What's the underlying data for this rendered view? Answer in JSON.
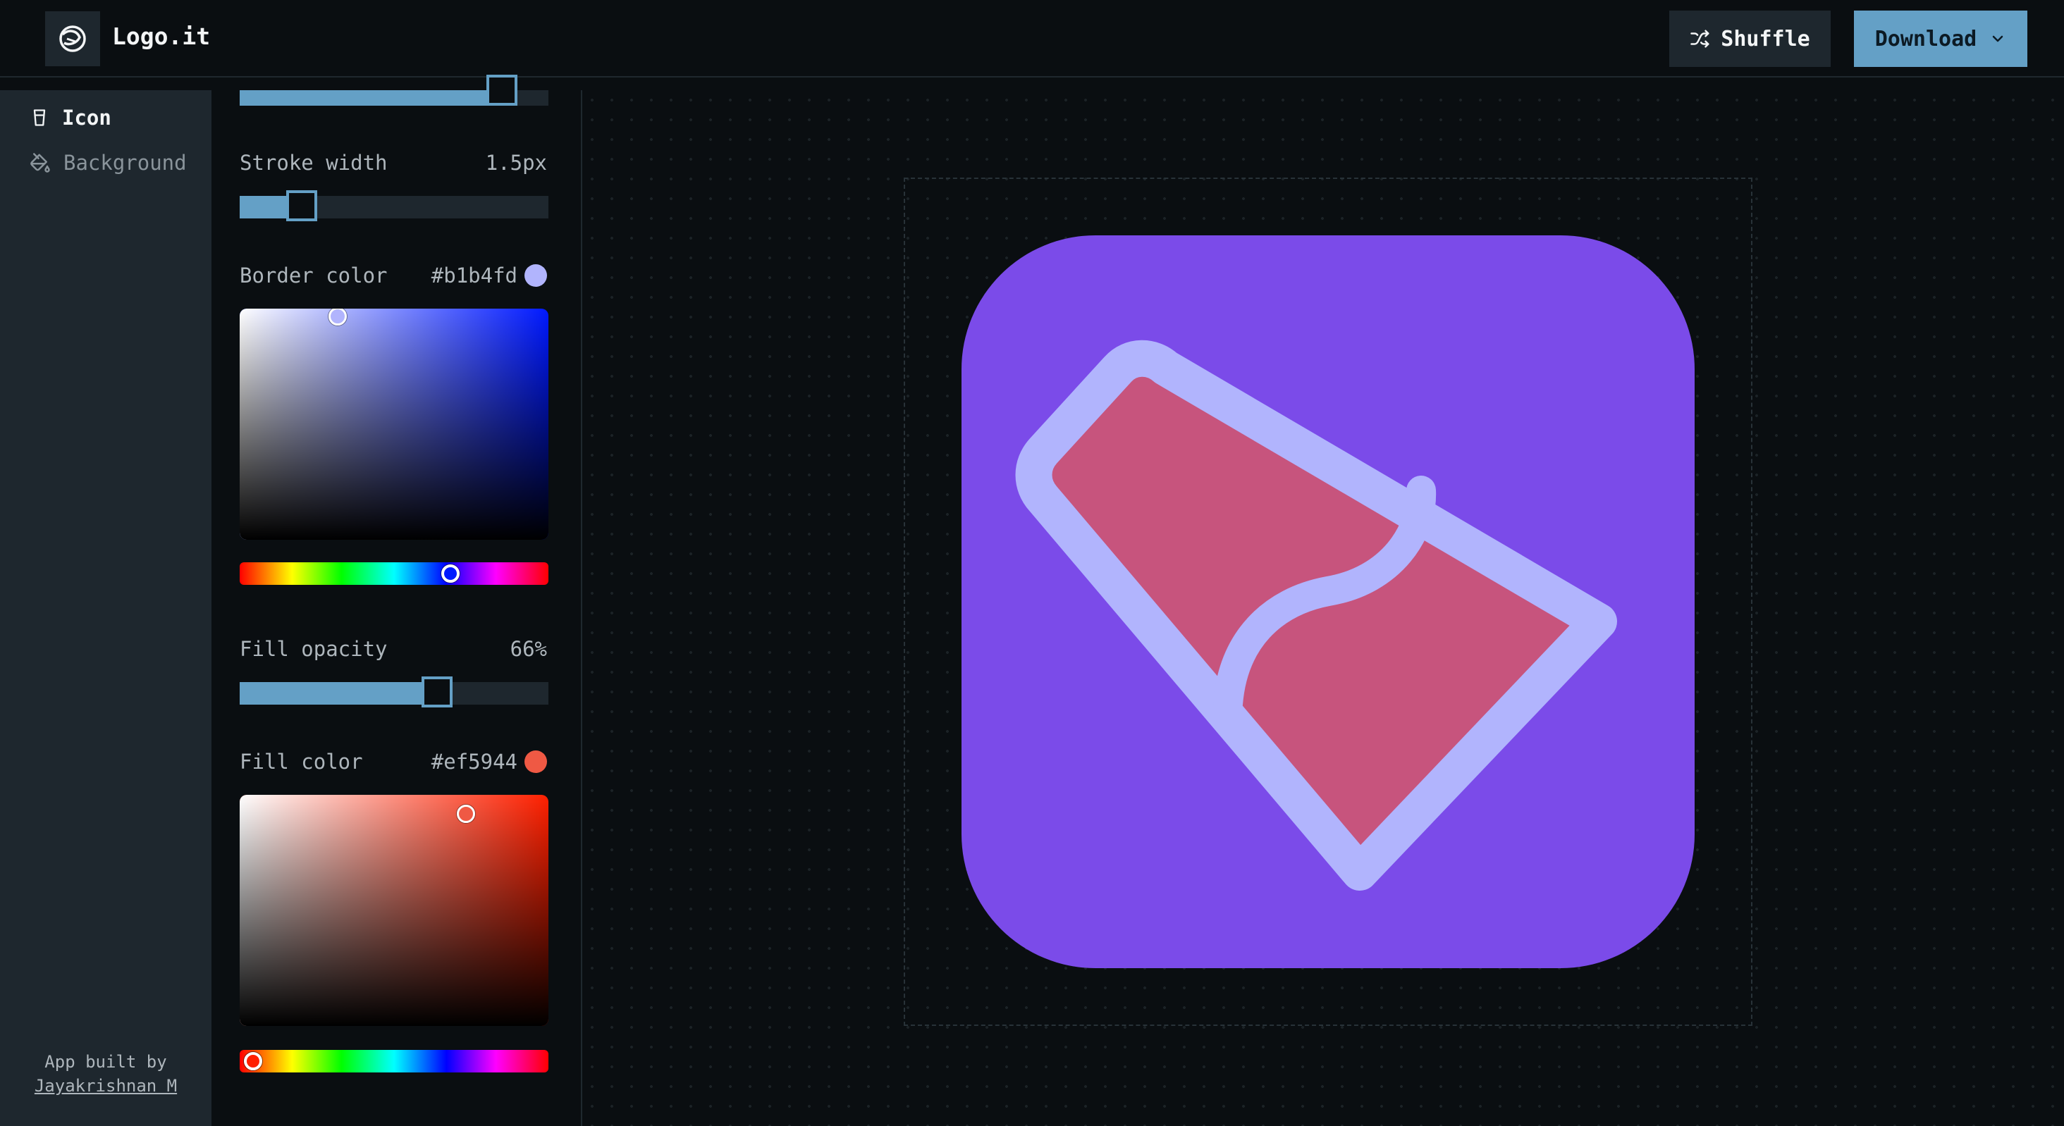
{
  "header": {
    "app_name": "Logo.it",
    "shuffle_label": "Shuffle",
    "download_label": "Download"
  },
  "nav": {
    "items": [
      {
        "label": "Icon",
        "icon": "glass-icon",
        "active": true
      },
      {
        "label": "Background",
        "icon": "paint-bucket-icon",
        "active": false
      }
    ],
    "credit_prefix": "App built by",
    "credit_name": "Jayakrishnan M"
  },
  "controls": {
    "top_slider_fraction": 0.88,
    "stroke_width": {
      "label": "Stroke width",
      "value": "1.5px",
      "fraction": 0.2
    },
    "border_color": {
      "label": "Border color",
      "value": "#b1b4fd",
      "hue_fraction": 0.68
    },
    "fill_opacity": {
      "label": "Fill opacity",
      "value": "66%",
      "fraction": 0.66
    },
    "fill_color": {
      "label": "Fill color",
      "value": "#ef5944",
      "hue_fraction": 0.04
    }
  },
  "colors": {
    "accent": "#64a0c6",
    "background_tile": "#7b4be9",
    "border": "#b1b4fd",
    "fill": "#ef5944"
  }
}
